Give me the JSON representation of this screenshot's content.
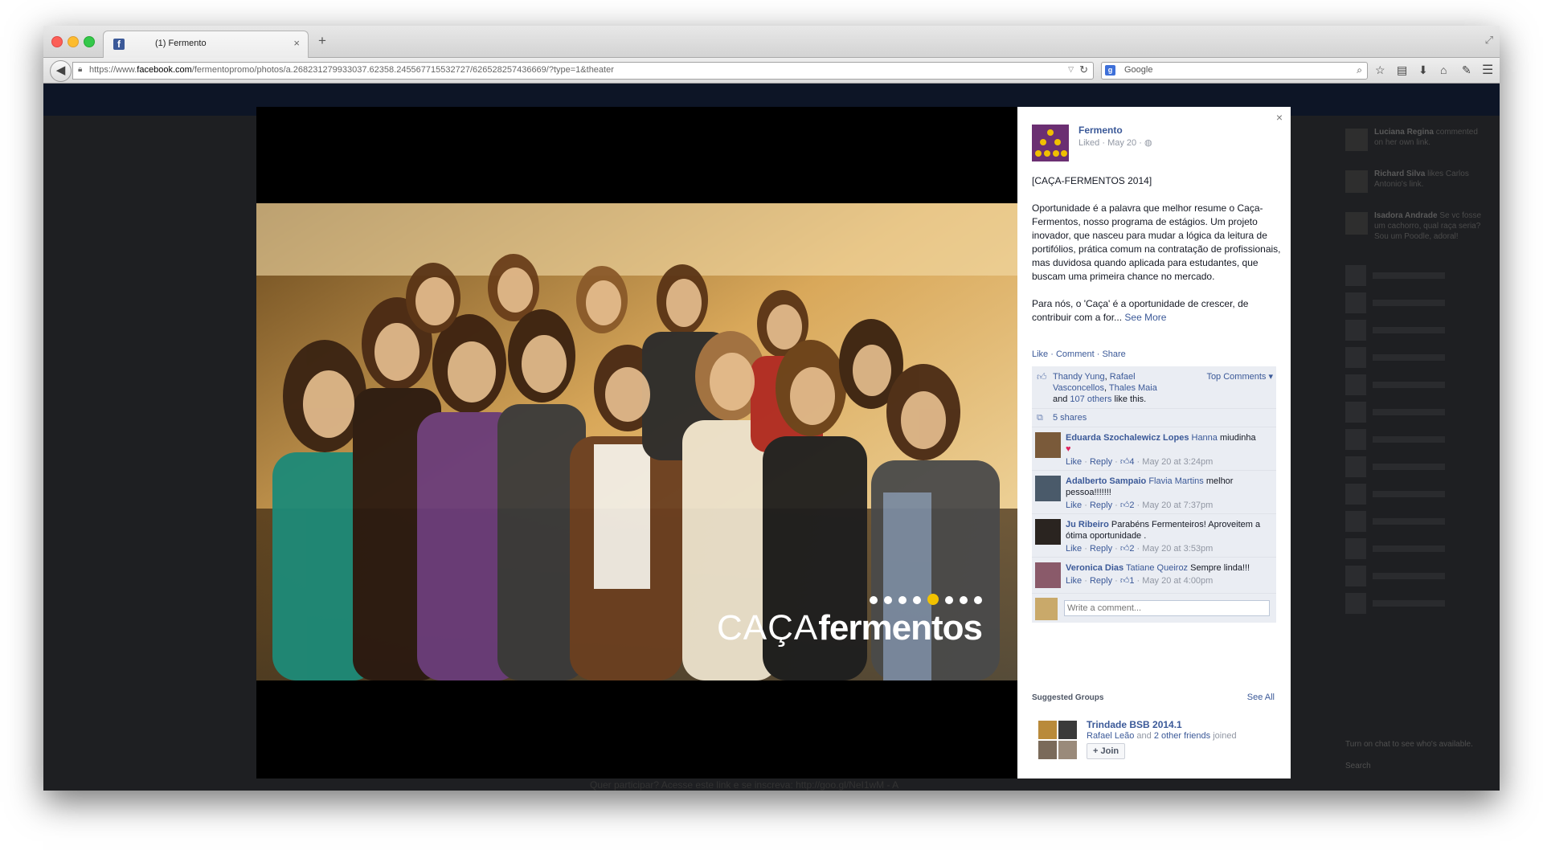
{
  "browser": {
    "tab_title": "(1) Fermento",
    "tab_close": "×",
    "new_tab": "+",
    "url_prefix": "https://www.",
    "url_domain": "facebook.com",
    "url_path": "/fermentopromo/photos/a.268231279933037.62358.245567715532727/626528257436669/?type=1&theater",
    "search_placeholder": "Google"
  },
  "page_bg": {
    "bottom_text": "Quer participar? Acesse este link e se inscreva: http://goo.gl/NeI1wM - A",
    "ticker": [
      {
        "name": "Luciana Regina",
        "text": "commented on her own link."
      },
      {
        "name": "Richard Silva",
        "text": "likes Carlos Antonio's link."
      },
      {
        "name": "Isadora Andrade",
        "text": "Se vc fosse um cachorro, qual raça seria? Sou um Poodle, adoral!"
      }
    ],
    "chat_footer": "Turn on chat to see who's available.",
    "chat_search": "Search"
  },
  "photo": {
    "overlay_word1": "CAÇA",
    "overlay_word2": "fermentos"
  },
  "post": {
    "page_name": "Fermento",
    "meta": "Liked · May 20 ·",
    "title_line": "[CAÇA-FERMENTOS 2014]",
    "paragraph1": "Oportunidade é a palavra que melhor resume o Caça-Fermentos, nosso programa de estágios. Um projeto inovador, que nasceu para mudar a lógica da leitura de portifólios, prática comum na contratação de profissionais, mas duvidosa quando aplicada para estudantes, que buscam uma primeira chance no mercado.",
    "paragraph2": "Para nós, o 'Caça' é a oportunidade de crescer, de contribuir com a for...",
    "see_more": "See More",
    "actions": {
      "like": "Like",
      "comment": "Comment",
      "share": "Share"
    },
    "likes": {
      "names1": "Thandy Yung",
      "names2": "Rafael Vasconcellos",
      "names3": "Thales Maia",
      "and": "and",
      "others": "107 others",
      "suffix": "like this.",
      "top_comments": "Top Comments ▾"
    },
    "shares": "5 shares",
    "comments": [
      {
        "name": "Eduarda Szochalewicz Lopes",
        "tag": "Hanna",
        "text": "miudinha",
        "extra": "♥",
        "like": "Like",
        "reply": "Reply",
        "count": "4",
        "time": "May 20 at 3:24pm"
      },
      {
        "name": "Adalberto Sampaio",
        "tag": "Flavia Martins",
        "text": "melhor pessoa!!!!!!!",
        "extra": "",
        "like": "Like",
        "reply": "Reply",
        "count": "2",
        "time": "May 20 at 7:37pm"
      },
      {
        "name": "Ju Ribeiro",
        "tag": "",
        "text": "Parabéns Fermenteiros! Aproveitem a ótima oportunidade .",
        "extra": "",
        "like": "Like",
        "reply": "Reply",
        "count": "2",
        "time": "May 20 at 3:53pm"
      },
      {
        "name": "Veronica Dias",
        "tag": "Tatiane Queiroz",
        "text": "Sempre linda!!!",
        "extra": "",
        "like": "Like",
        "reply": "Reply",
        "count": "1",
        "time": "May 20 at 4:00pm"
      }
    ],
    "write_placeholder": "Write a comment..."
  },
  "suggested": {
    "heading": "Suggested Groups",
    "see_all": "See All",
    "group_name": "Trindade BSB 2014.1",
    "friend": "Rafael Leão",
    "and": "and",
    "others": "2 other friends",
    "joined": "joined",
    "join_label": "+ Join"
  },
  "colors": {
    "fb_blue": "#3b5998",
    "page_avatar": "#6b2f72",
    "logo_yellow": "#f0c000"
  }
}
